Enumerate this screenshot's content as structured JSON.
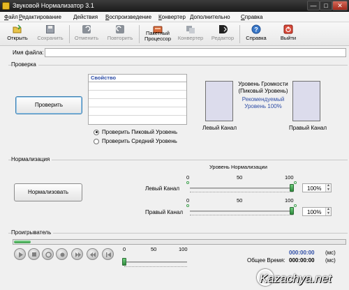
{
  "window": {
    "title": "Звуковой Нормализатор 3.1",
    "min": "—",
    "max": "□",
    "close": "✕"
  },
  "menu": {
    "items": [
      {
        "first": "Ф",
        "rest": "айл"
      },
      {
        "first": "Р",
        "rest": "едактирование"
      },
      {
        "first": "Д",
        "rest": "ействия"
      },
      {
        "first": "В",
        "rest": "оспроизведение"
      },
      {
        "first": "К",
        "rest": "онвертер"
      },
      {
        "first": "Д",
        "rest": "ополнительно"
      },
      {
        "first": "С",
        "rest": "правка"
      }
    ]
  },
  "toolbar": {
    "open": "Открыть",
    "save": "Сохранить",
    "undo": "Отменить",
    "redo": "Повторить",
    "batch_1": "Пакетный",
    "batch_2": "Процессор",
    "converter": "Конвертер",
    "editor": "Редактор",
    "help": "Справка",
    "exit": "Выйти"
  },
  "file": {
    "label": "Имя файла:",
    "value": ""
  },
  "check": {
    "group": "Проверка",
    "button": "Проверить",
    "property_header": "Свойство",
    "radio_peak": "Проверить Пиковый Уровень",
    "radio_avg": "Проверить Средний Уровень",
    "volume_1": "Уровень Громкости",
    "volume_2": "(Пиковый Уровень)",
    "recommended_1": "Рекомендуемый",
    "recommended_2": "Уровень 100%",
    "left_channel": "Левый Канал",
    "right_channel": "Правый Канал"
  },
  "normalization": {
    "group": "Нормализация",
    "button": "Нормализовать",
    "level_title": "Уровень Нормализации",
    "left_label": "Левый Канал",
    "right_label": "Правый Канал",
    "scale": {
      "min": "0",
      "mid": "50",
      "max": "100"
    },
    "left_value": "100%",
    "right_value": "100%",
    "left_level": 1.0,
    "right_level": 1.0
  },
  "player": {
    "group": "Проигрыватель",
    "volume_scale": {
      "min": "0",
      "mid": "50",
      "max": "100"
    },
    "volume_level": 0.0,
    "position": "000:00:00",
    "position_unit": "(мс)",
    "total_label": "Общее Время:",
    "total": "000:00:00",
    "total_unit": "(мс)"
  },
  "watermark": {
    "text": "Kazachya.net"
  },
  "colors": {
    "accent": "#2e4da6",
    "slider": "#3a9a48",
    "meter": "#dcdcec"
  }
}
